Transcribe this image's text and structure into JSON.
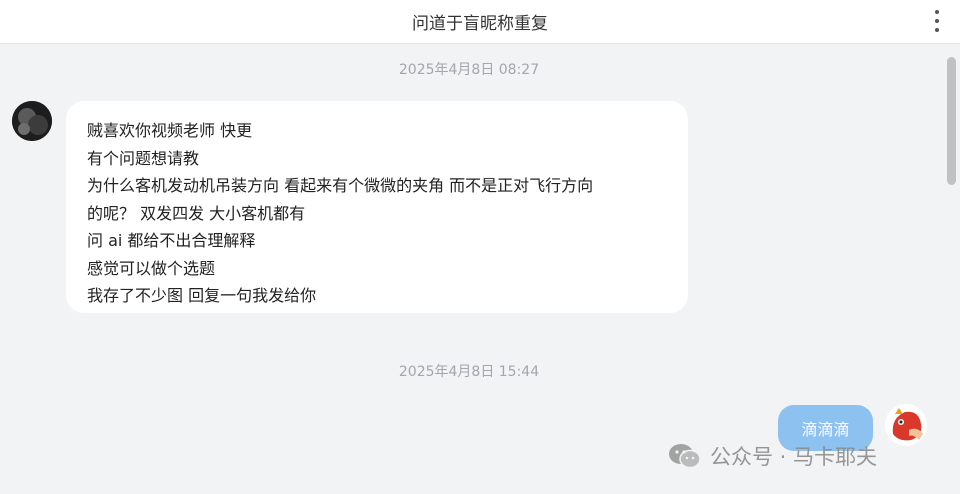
{
  "header": {
    "title": "问道于盲昵称重复"
  },
  "messages": {
    "stamp1": "2025年4月8日 08:27",
    "left_bubble_lines": [
      "贼喜欢你视频老师 快更",
      "有个问题想请教",
      "为什么客机发动机吊装方向 看起来有个微微的夹角 而不是正对飞行方向",
      "的呢？ 双发四发 大小客机都有",
      "问 ai 都给不出合理解释",
      "感觉可以做个选题",
      "我存了不少图 回复一句我发给你"
    ],
    "stamp2": "2025年4月8日 15:44",
    "right_bubble": "滴滴滴"
  },
  "watermark": {
    "text": "公众号 · 马卡耶夫"
  },
  "icons": [
    "more-vertical-icon",
    "wechat-icon"
  ]
}
